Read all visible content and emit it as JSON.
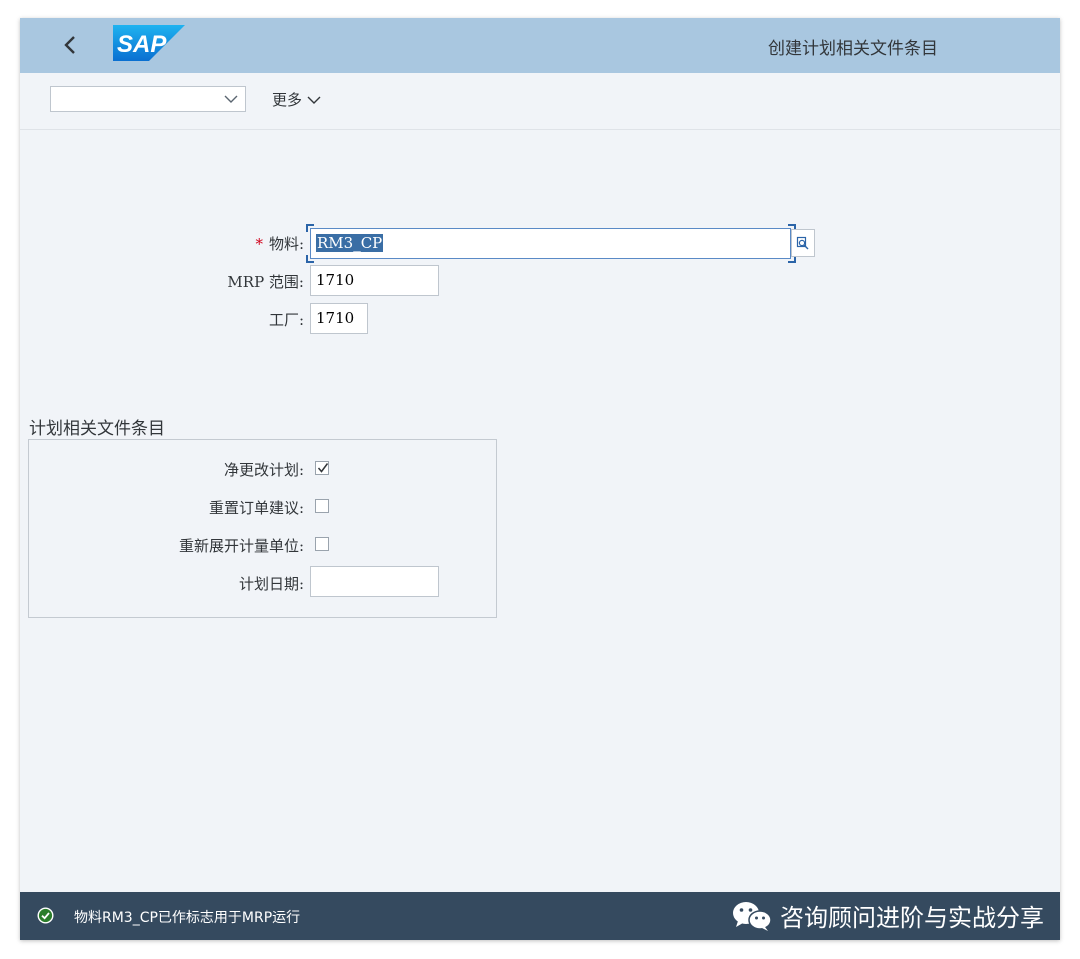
{
  "shell": {
    "logo_text": "SAP",
    "title": "创建计划相关文件条目"
  },
  "toolbar": {
    "select_value": "",
    "more_label": "更多"
  },
  "form": {
    "material": {
      "label": "物料:",
      "required_mark": "*",
      "value": "RM3_CP"
    },
    "mrp_area": {
      "label": "MRP 范围:",
      "value": "1710"
    },
    "plant": {
      "label": "工厂:",
      "value": "1710"
    }
  },
  "group": {
    "title": "计划相关文件条目",
    "net_change": {
      "label": "净更改计划:",
      "checked": true
    },
    "reset_proposals": {
      "label": "重置订单建议:",
      "checked": false
    },
    "reexplode_uom": {
      "label": "重新展开计量单位:",
      "checked": false
    },
    "planning_date": {
      "label": "计划日期:",
      "value": ""
    }
  },
  "status": {
    "type": "success",
    "message": "物料RM3_CP已作标志用于MRP运行"
  },
  "watermark": {
    "text": "咨询顾问进阶与实战分享",
    "icon": "wechat-icon"
  },
  "colors": {
    "shell_bg": "#a9c7e0",
    "page_bg": "#f1f4f8",
    "status_bg": "#354a5f",
    "required": "#d0021b",
    "success": "#2b7d2b"
  }
}
